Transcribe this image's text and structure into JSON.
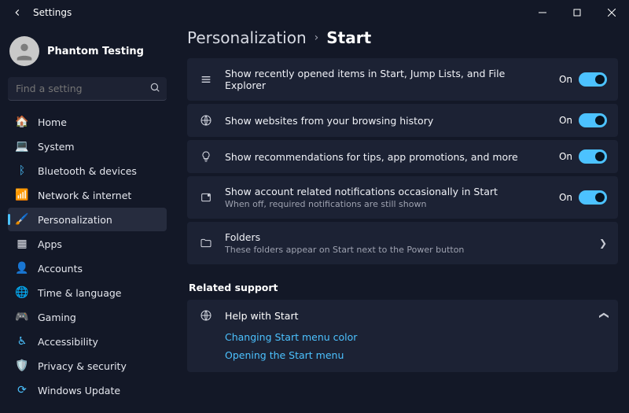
{
  "window": {
    "title": "Settings"
  },
  "user": {
    "name": "Phantom Testing"
  },
  "search": {
    "placeholder": "Find a setting"
  },
  "sidebar": {
    "items": [
      {
        "label": "Home"
      },
      {
        "label": "System"
      },
      {
        "label": "Bluetooth & devices"
      },
      {
        "label": "Network & internet"
      },
      {
        "label": "Personalization"
      },
      {
        "label": "Apps"
      },
      {
        "label": "Accounts"
      },
      {
        "label": "Time & language"
      },
      {
        "label": "Gaming"
      },
      {
        "label": "Accessibility"
      },
      {
        "label": "Privacy & security"
      },
      {
        "label": "Windows Update"
      }
    ]
  },
  "breadcrumb": {
    "parent": "Personalization",
    "current": "Start"
  },
  "settings": [
    {
      "title": "Show recently opened items in Start, Jump Lists, and File Explorer",
      "state": "On"
    },
    {
      "title": "Show websites from your browsing history",
      "state": "On"
    },
    {
      "title": "Show recommendations for tips, app promotions, and more",
      "state": "On"
    },
    {
      "title": "Show account related notifications occasionally in Start",
      "sub": "When off, required notifications are still shown",
      "state": "On"
    }
  ],
  "folders": {
    "title": "Folders",
    "sub": "These folders appear on Start next to the Power button"
  },
  "support": {
    "heading": "Related support",
    "title": "Help with Start",
    "links": [
      "Changing Start menu color",
      "Opening the Start menu"
    ]
  }
}
